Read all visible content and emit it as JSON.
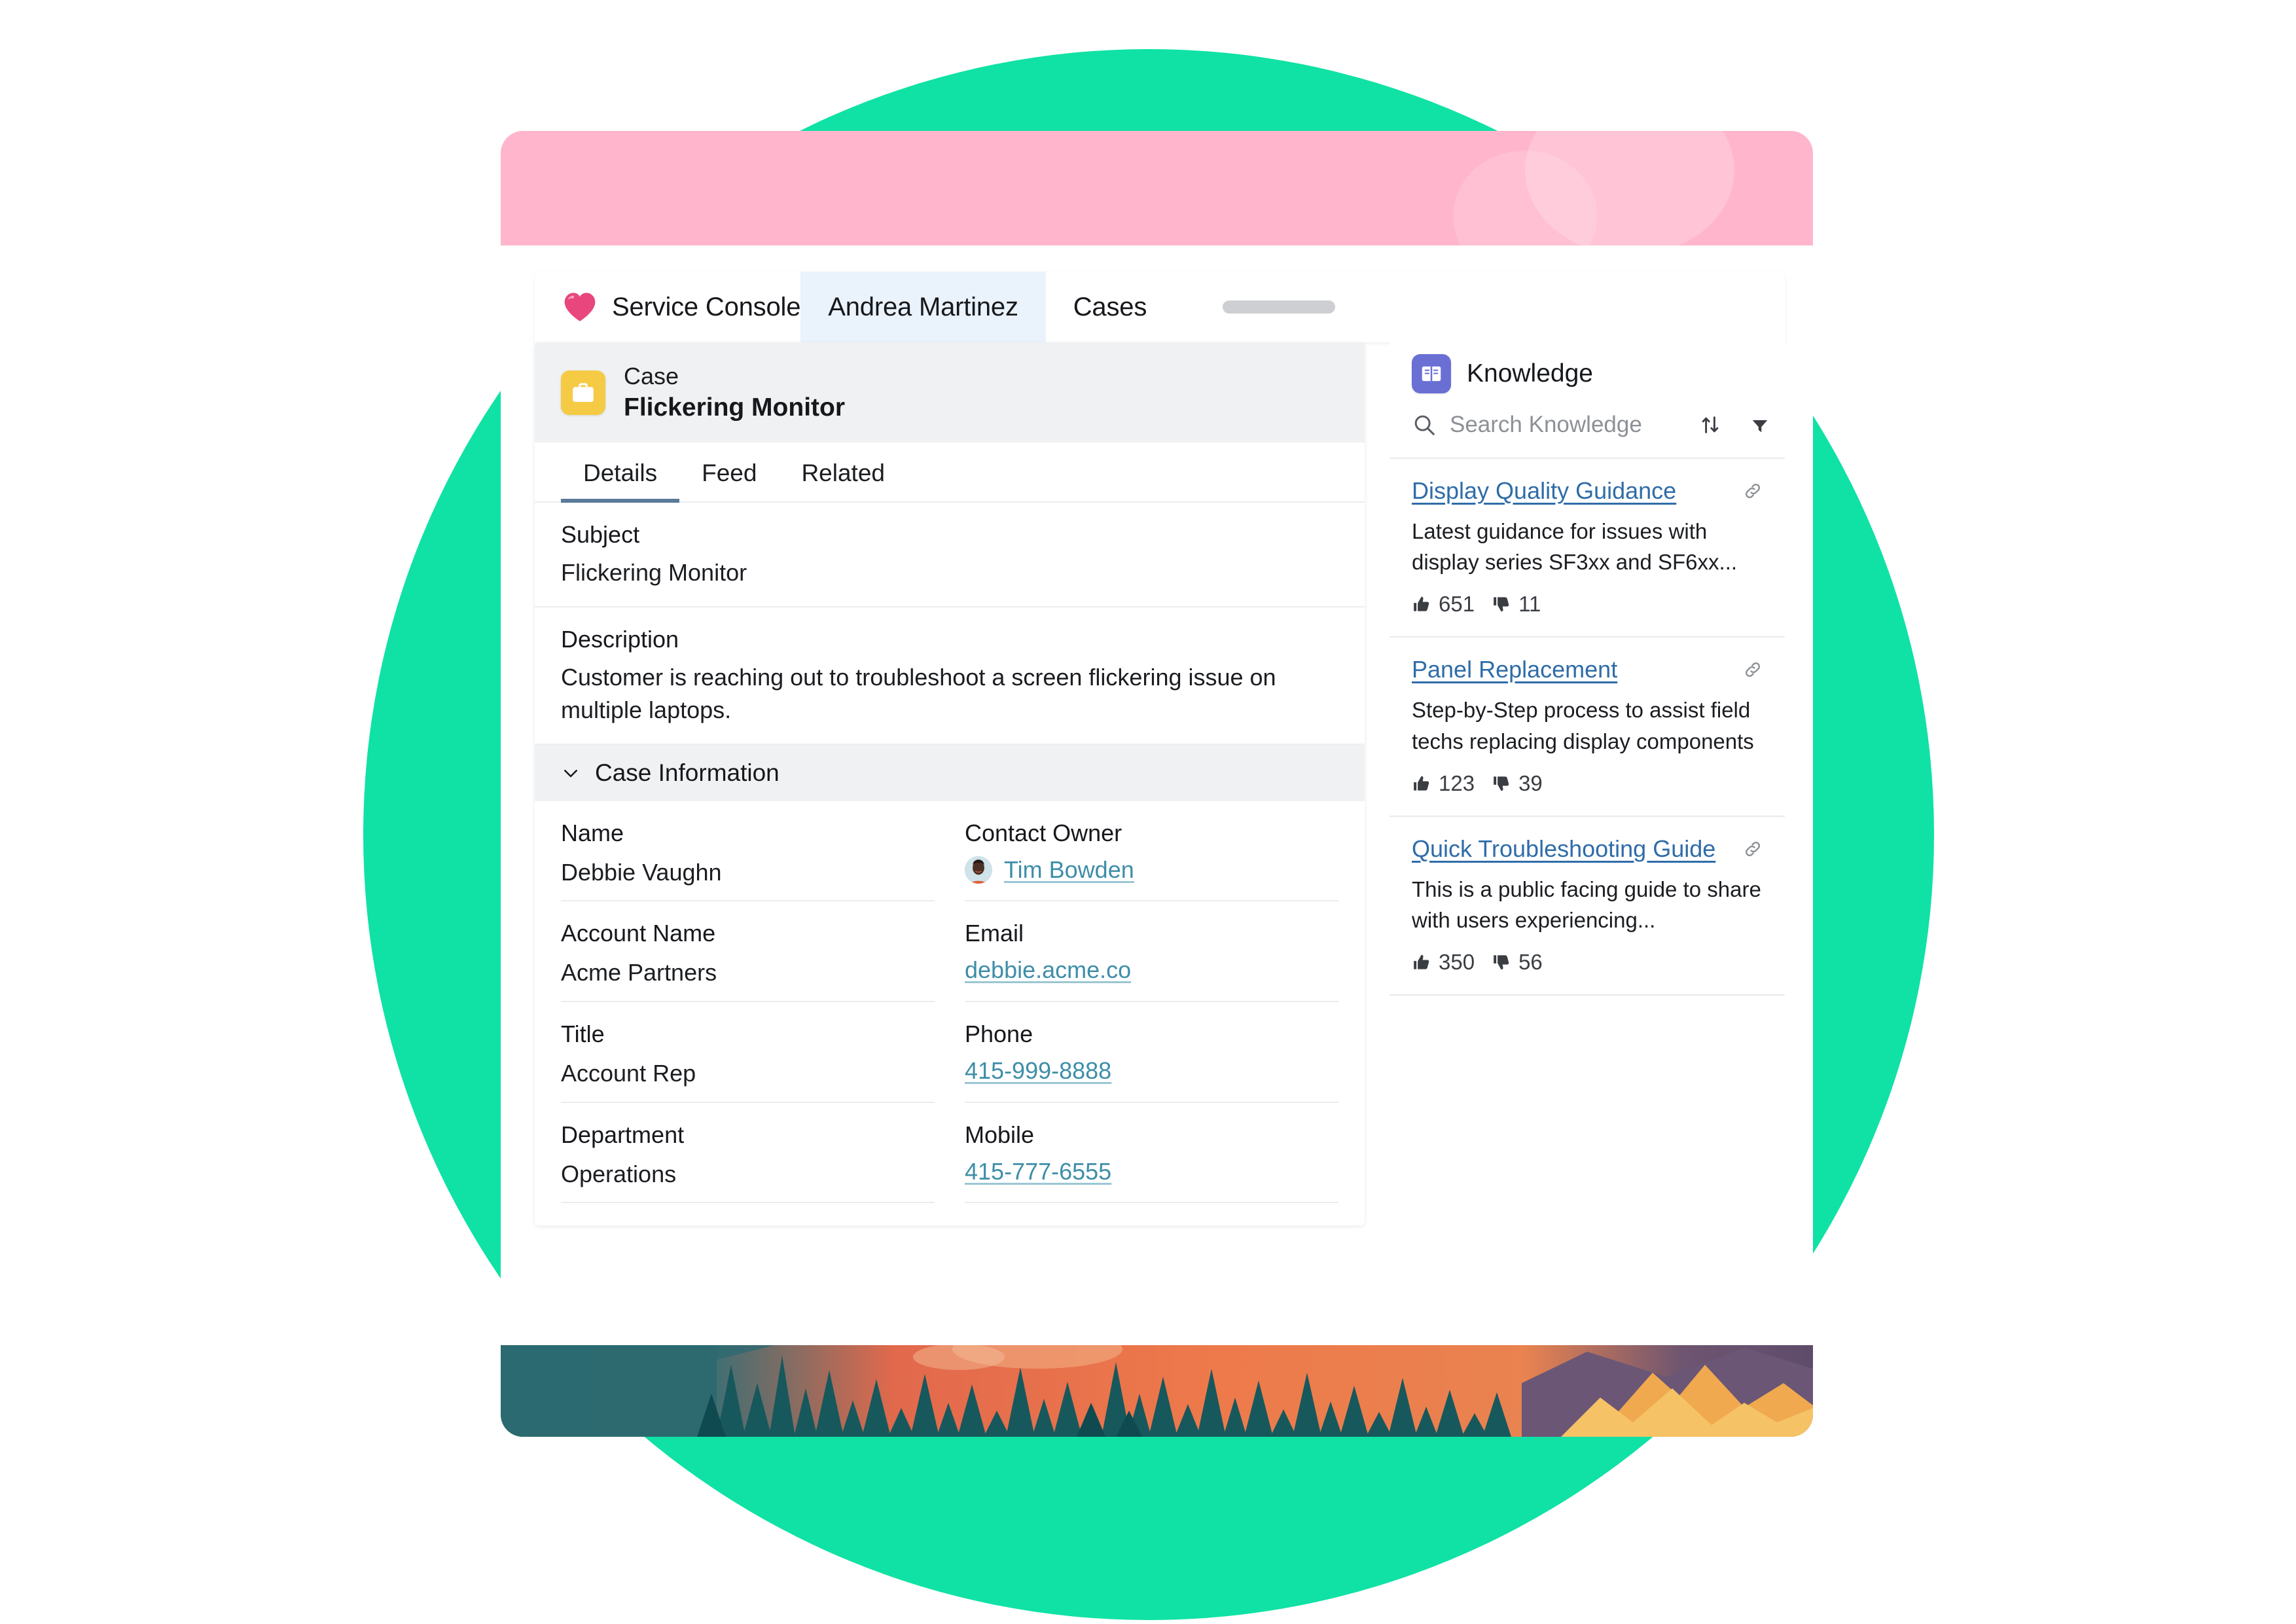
{
  "theme": {
    "green": "#0FE2A4",
    "pink": "#FFB6CC",
    "case_icon": "#F5CB46",
    "knowledge_icon": "#6A6FD4",
    "link_blue": "#2F6CA8",
    "value_link": "#3E8EA8",
    "tab_active_underline": "#5A7A9A",
    "tab_highlight": "#EAF2FB"
  },
  "console": {
    "brand_icon": "heart-icon",
    "brand_label": "Service Console",
    "tabs": [
      {
        "label": "Andrea Martinez",
        "active": true
      },
      {
        "label": "Cases",
        "active": false
      }
    ],
    "skeleton_placeholder": ""
  },
  "record": {
    "icon": "case-icon",
    "type": "Case",
    "name": "Flickering Monitor",
    "tabs": [
      {
        "label": "Details",
        "active": true
      },
      {
        "label": "Feed",
        "active": false
      },
      {
        "label": "Related",
        "active": false
      }
    ],
    "fields": [
      {
        "label": "Subject",
        "value": "Flickering Monitor"
      },
      {
        "label": "Description",
        "value": "Customer is reaching out to troubleshoot a screen flickering issue on multiple laptops."
      }
    ],
    "section": {
      "title": "Case Information",
      "collapse_icon": "chevron-down-icon",
      "rows": [
        {
          "left": {
            "label": "Name",
            "value": "Debbie Vaughn",
            "kind": "text"
          },
          "right": {
            "label": "Contact Owner",
            "value": "Tim Bowden",
            "kind": "link",
            "avatar": "avatar"
          }
        },
        {
          "left": {
            "label": "Account Name",
            "value": "Acme Partners",
            "kind": "text"
          },
          "right": {
            "label": "Email",
            "value": "debbie.acme.co",
            "kind": "link"
          }
        },
        {
          "left": {
            "label": "Title",
            "value": "Account Rep",
            "kind": "text"
          },
          "right": {
            "label": "Phone",
            "value": "415-999-8888",
            "kind": "link"
          }
        },
        {
          "left": {
            "label": "Department",
            "value": "Operations",
            "kind": "text"
          },
          "right": {
            "label": "Mobile",
            "value": "415-777-6555",
            "kind": "link"
          }
        }
      ]
    }
  },
  "knowledge": {
    "icon": "book-icon",
    "title": "Knowledge",
    "search_placeholder": "Search Knowledge",
    "search_value": "",
    "search_icon": "search-icon",
    "sort_icon": "sort-icon",
    "filter_icon": "filter-icon",
    "articles": [
      {
        "title": "Display Quality Guidance",
        "description": "Latest guidance for issues with display series SF3xx and SF6xx...",
        "thumbs_up": "651",
        "thumbs_down": "11",
        "link_icon": "link-icon"
      },
      {
        "title": "Panel Replacement",
        "description": "Step-by-Step process to assist field techs replacing display components",
        "thumbs_up": "123",
        "thumbs_down": "39",
        "link_icon": "link-icon"
      },
      {
        "title": "Quick Troubleshooting Guide",
        "description": "This is a public facing guide to share with users experiencing...",
        "thumbs_up": "350",
        "thumbs_down": "56",
        "link_icon": "link-icon"
      }
    ]
  }
}
